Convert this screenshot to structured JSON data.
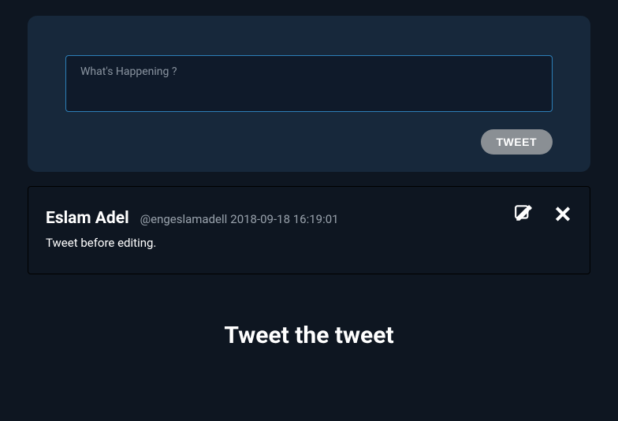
{
  "compose": {
    "placeholder": "What's Happening ?",
    "submit_label": "TWEET"
  },
  "tweets": [
    {
      "name": "Eslam Adel",
      "handle": "@engeslamadell",
      "timestamp": "2018-09-18 16:19:01",
      "body": "Tweet before editing."
    }
  ],
  "section_heading": "Tweet the tweet",
  "icons": {
    "edit": "edit-icon",
    "delete": "close-icon"
  },
  "colors": {
    "page_bg": "#0e1621",
    "panel_bg": "#17283b",
    "input_border": "#2d7fb8",
    "muted_text": "#99a2ac"
  }
}
